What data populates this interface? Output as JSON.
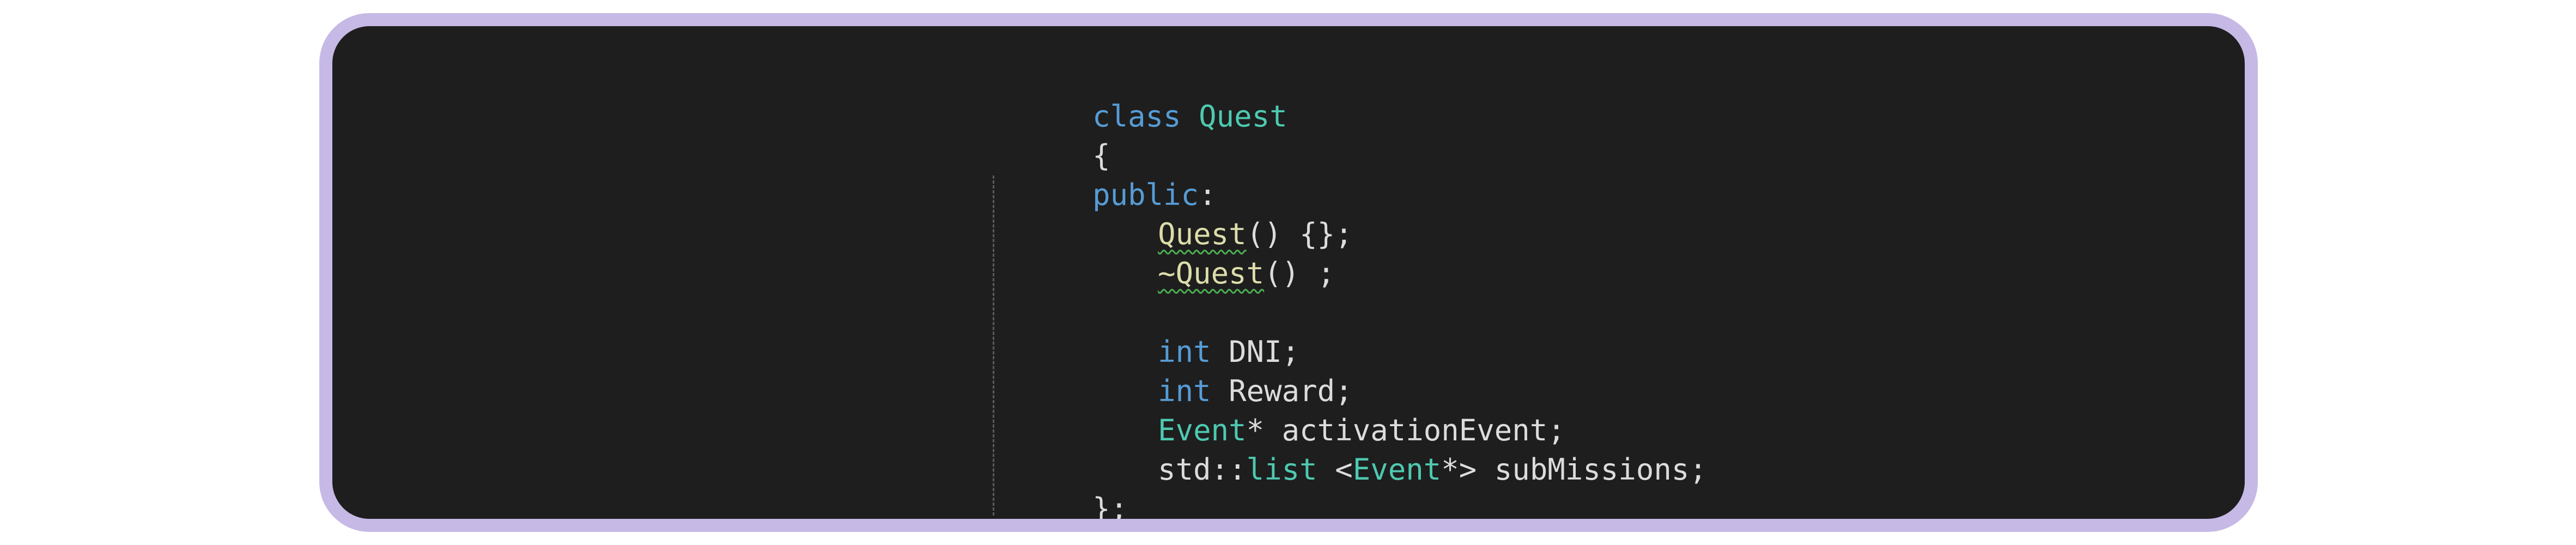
{
  "colors": {
    "frame_border": "#c7b9e6",
    "editor_background": "#1e1e1e",
    "keyword": "#569cd6",
    "type": "#4ec9b0",
    "function": "#dcdcaa",
    "text": "#dcdcdc",
    "warning_squiggle": "#4caf50"
  },
  "code": {
    "line1": {
      "kw": "class",
      "space": " ",
      "name": "Quest"
    },
    "line2": {
      "text": "{"
    },
    "line3": {
      "kw": "public",
      "colon": ":"
    },
    "line4": {
      "fn": "Quest",
      "rest": "() {};"
    },
    "line5": {
      "fn": "~Quest",
      "rest": "() ;"
    },
    "line6": {
      "text": ""
    },
    "line7": {
      "kw": "int",
      "rest": " DNI;"
    },
    "line8": {
      "kw": "int",
      "rest": " Reward;"
    },
    "line9": {
      "type": "Event",
      "rest": "* activationEvent;"
    },
    "line10": {
      "pre": "std::",
      "type1": "list",
      "mid": " <",
      "type2": "Event",
      "rest": "*> subMissions;"
    },
    "line11": {
      "text": "};"
    }
  }
}
